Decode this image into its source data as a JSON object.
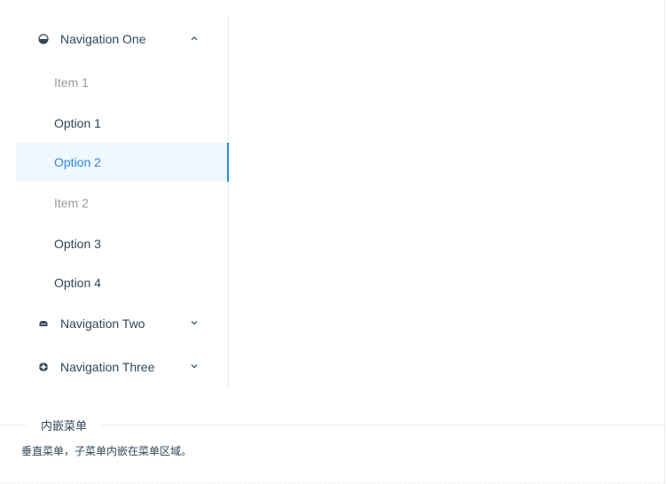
{
  "menu": {
    "nav_one": {
      "label": "Navigation One",
      "icon": "mail-icon",
      "expanded": true
    },
    "item1_group": {
      "label": "Item 1"
    },
    "option1": {
      "label": "Option 1"
    },
    "option2": {
      "label": "Option 2",
      "selected": true
    },
    "item2_group": {
      "label": "Item 2"
    },
    "option3": {
      "label": "Option 3"
    },
    "option4": {
      "label": "Option 4"
    },
    "nav_two": {
      "label": "Navigation Two",
      "icon": "appstore-icon",
      "expanded": false
    },
    "nav_three": {
      "label": "Navigation Three",
      "icon": "setting-icon",
      "expanded": false
    }
  },
  "demo": {
    "title": "内嵌菜单",
    "description": "垂直菜单，子菜单内嵌在菜单区域。"
  },
  "colors": {
    "accent": "#2f84dd",
    "selected_bg": "#f0f8ff",
    "group_title": "#999999",
    "text": "#314659"
  }
}
